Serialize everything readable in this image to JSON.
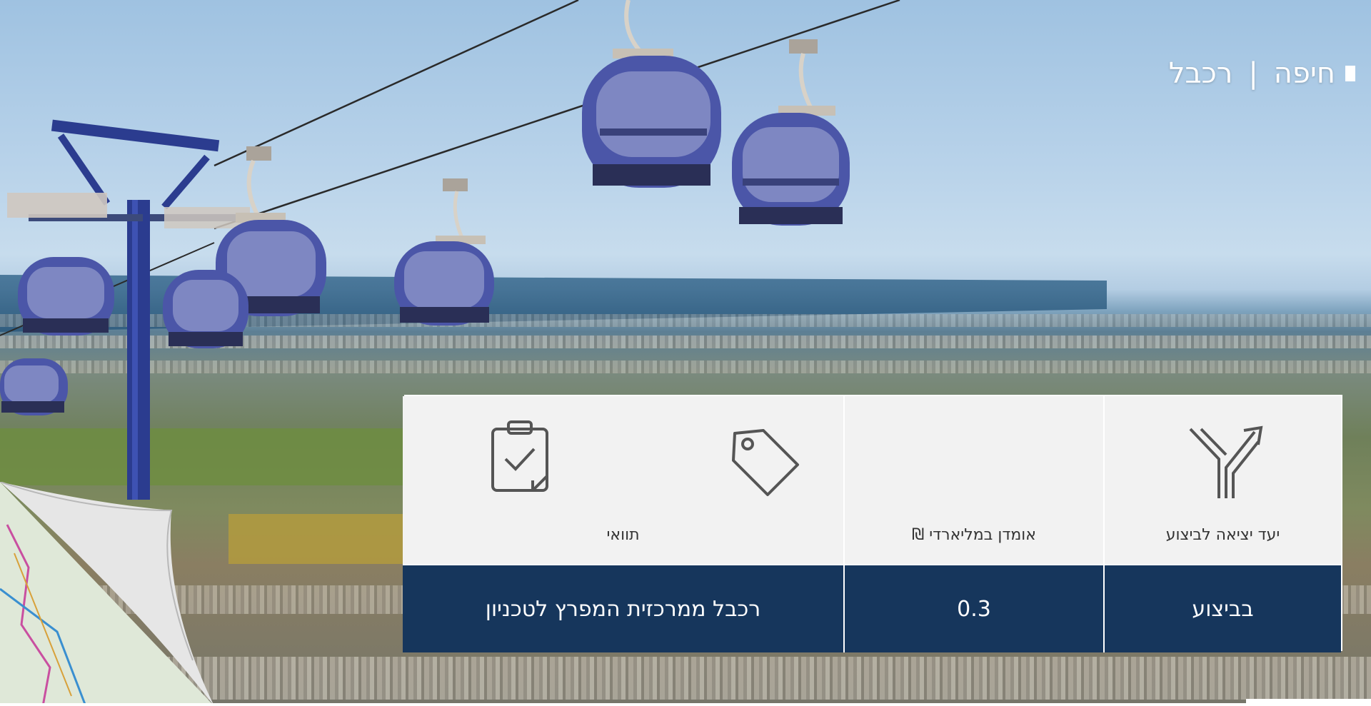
{
  "breadcrumb": {
    "city": "חיפה",
    "separator": "|",
    "project": "רכבל"
  },
  "info_card": {
    "headers": [
      {
        "label": "יעד יציאה לביצוע",
        "icon": "route-split-icon"
      },
      {
        "label": "אומדן במליארדי ₪",
        "icon": "price-tag-icon"
      },
      {
        "label": "תוואי",
        "icon": "clipboard-check-icon"
      }
    ],
    "values": {
      "status": "בביצוע",
      "cost": "0.3",
      "route": "רכבל ממרכזית המפרץ לטכניון"
    }
  },
  "colors": {
    "card_dark": "#16365c",
    "card_light": "#f2f2f2",
    "gondola_blue": "#4b56a8"
  }
}
